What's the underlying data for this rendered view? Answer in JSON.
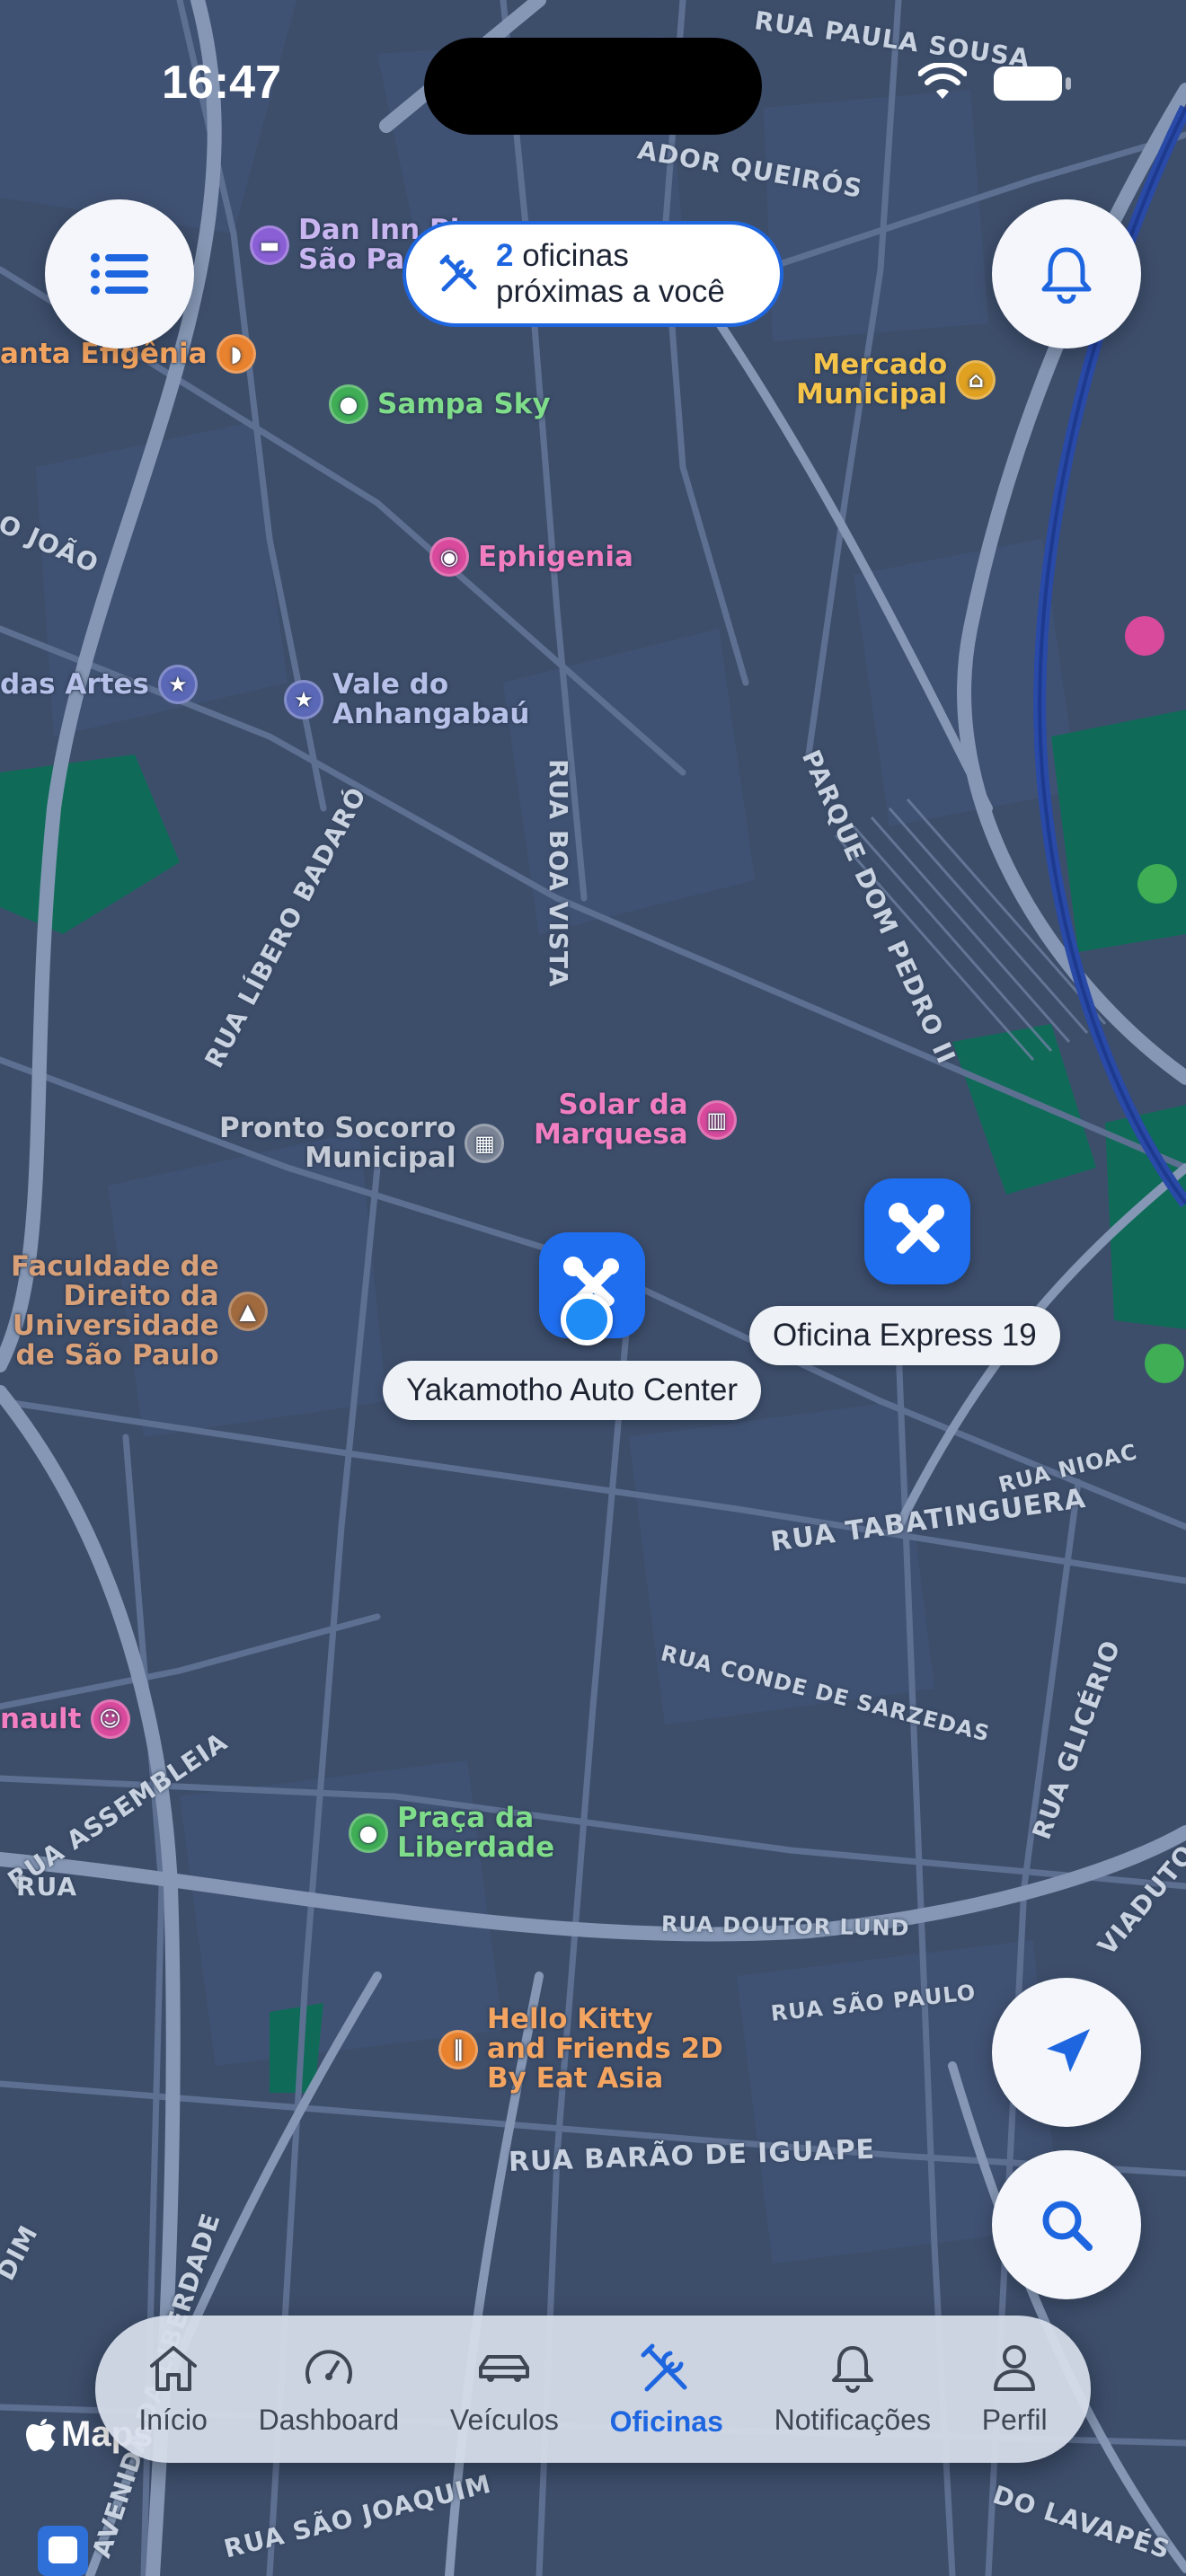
{
  "status_bar": {
    "time": "16:47"
  },
  "banner": {
    "count": "2",
    "line1_rest": " oficinas",
    "line2": "próximas a você"
  },
  "colors": {
    "accent": "#1e66e0",
    "map_bg": "#3d4e6b",
    "road": "#6a7c98",
    "park": "#0f6b58",
    "rail": "#2a4aa8"
  },
  "map": {
    "streets": [
      "RUA PAULA SOUSA",
      "ADOR QUEIRÓS",
      "O JOÃO",
      "RUA LÍBERO BADARÓ",
      "RUA BOA VISTA",
      "PARQUE DOM PEDRO II",
      "RUA NIOAC",
      "RUA TABATINGUERA",
      "RUA CONDE DE SARZEDAS",
      "RUA GLICÉRIO",
      "VIADUTO DO",
      "RUA DOUTOR LUND",
      "RUA SÃO PAULO",
      "RUA ASSEMBLEIA",
      "RUA BARÃO DE IGUAPE",
      "AVENIDA DA LIBERDADE",
      "RUA SÃO JOAQUIM",
      "DO LAVAPÉS",
      "DIM",
      "IDA DA",
      "RUA"
    ],
    "pois": {
      "dan_inn": [
        "Dan Inn Pl",
        "São Pa"
      ],
      "santa_efigenia": "anta Efigênia",
      "sampa_sky": "Sampa Sky",
      "mercado": [
        "Mercado",
        "Municipal"
      ],
      "ephigenia": "Ephigenia",
      "das_artes": "das Artes",
      "vale": [
        "Vale do",
        "Anhangabaú"
      ],
      "solar": [
        "Solar da",
        "Marquesa"
      ],
      "pronto_socorro": [
        "Pronto Socorro",
        "Municipal"
      ],
      "faculdade": [
        "Faculdade de",
        "Direito da",
        "Universidade",
        "de São Paulo"
      ],
      "renault": "nault",
      "praca": [
        "Praça da",
        "Liberdade"
      ],
      "hello_kitty": [
        "Hello Kitty",
        "and Friends 2D",
        "By Eat Asia"
      ]
    },
    "attribution": "Maps"
  },
  "workshops": [
    {
      "name": "Yakamotho Auto Center"
    },
    {
      "name": "Oficina Express 19"
    }
  ],
  "tabs": [
    {
      "label": "Início",
      "icon": "house-icon"
    },
    {
      "label": "Dashboard",
      "icon": "speedometer-icon"
    },
    {
      "label": "Veículos",
      "icon": "car-icon"
    },
    {
      "label": "Oficinas",
      "icon": "tools-icon",
      "active": true
    },
    {
      "label": "Notificações",
      "icon": "bell-icon"
    },
    {
      "label": "Perfil",
      "icon": "person-icon"
    }
  ]
}
